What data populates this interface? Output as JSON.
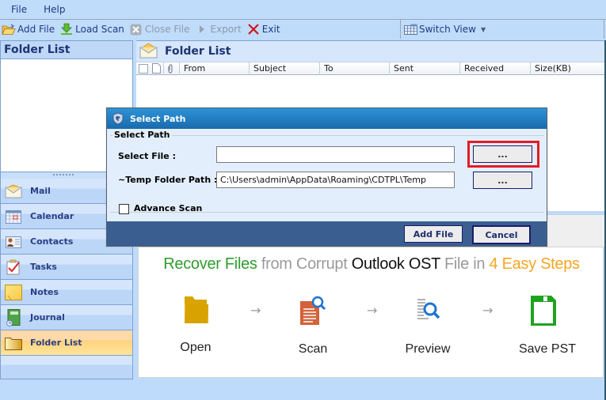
{
  "menu": {
    "items": [
      "File",
      "Help"
    ]
  },
  "toolbar": {
    "add_file": "Add File",
    "load_scan": "Load Scan",
    "close_file": "Close File",
    "export": "Export",
    "exit": "Exit",
    "switch_view": "Switch View"
  },
  "left_panel": {
    "title": "Folder List",
    "nav": [
      "Mail",
      "Calendar",
      "Contacts",
      "Tasks",
      "Notes",
      "Journal",
      "Folder List"
    ],
    "active": "Folder List"
  },
  "right_panel": {
    "title": "Folder List",
    "columns": [
      "From",
      "Subject",
      "To",
      "Sent",
      "Received",
      "Size(KB)"
    ]
  },
  "promo": {
    "title_parts": [
      "Recover Files",
      " from Corrupt ",
      "Outlook OST",
      " File in ",
      "4 Easy Steps"
    ],
    "steps": [
      "Open",
      "Scan",
      "Preview",
      "Save PST"
    ],
    "arrow": "→"
  },
  "dialog": {
    "title": "Select Path",
    "group_label": "Select Path",
    "select_file_label": "Select File :",
    "select_file_value": "",
    "temp_path_label": "~Temp Folder Path :",
    "temp_path_value": "C:\\Users\\admin\\AppData\\Roaming\\CDTPL\\Temp",
    "browse_label": "...",
    "advance_scan_label": "Advance Scan",
    "advance_scan_checked": false,
    "add_file_button": "Add File",
    "cancel_button": "Cancel"
  },
  "colors": {
    "highlight": "#e41b23",
    "title_green": "#2e9e2e",
    "title_orange": "#f5a623"
  }
}
